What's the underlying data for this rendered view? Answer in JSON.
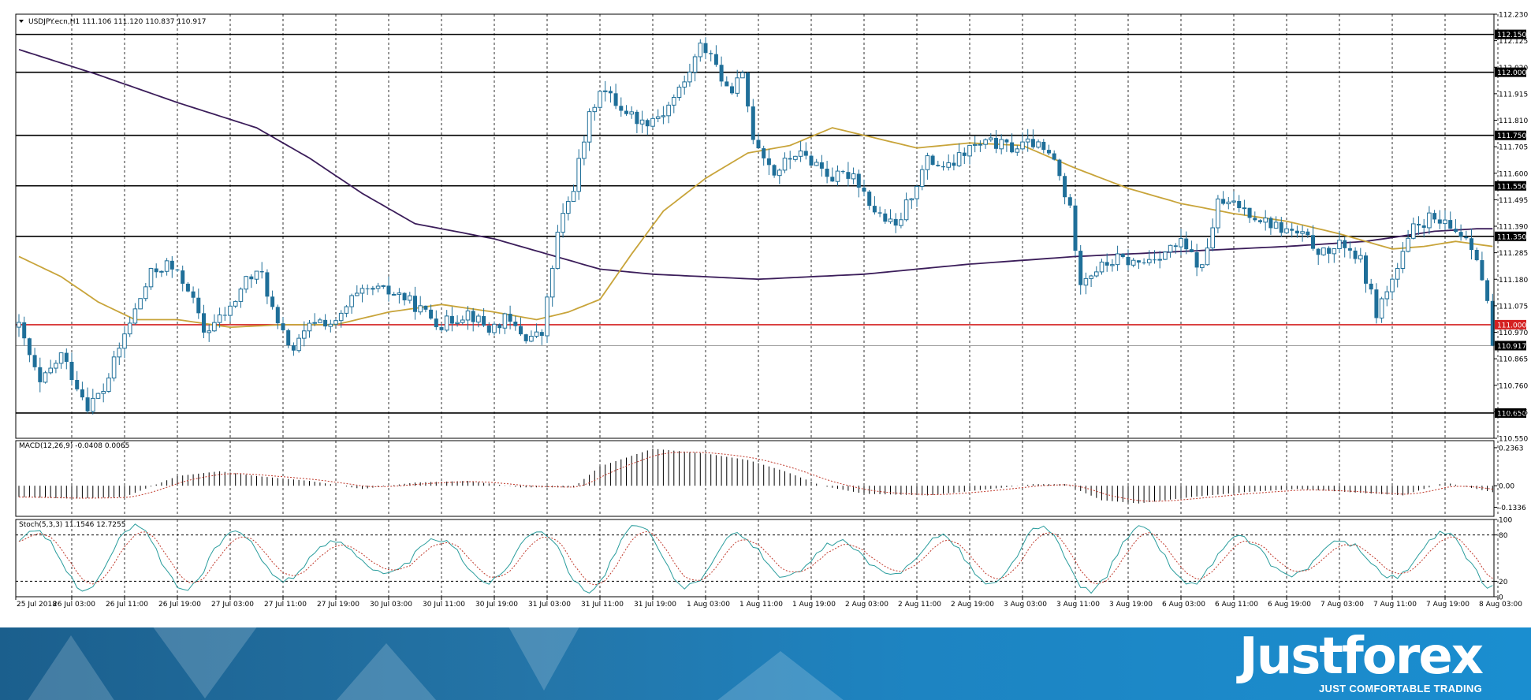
{
  "chart_data": [
    {
      "type": "candlestick",
      "title": "USDJPY.ecn,H1",
      "ohlc_readout": "111.106 111.120 110.837 110.917",
      "ylim": [
        110.55,
        112.23
      ],
      "y_ticks": [
        "112.230",
        "112.125",
        "112.020",
        "111.915",
        "111.810",
        "111.705",
        "111.600",
        "111.495",
        "111.390",
        "111.285",
        "111.180",
        "111.075",
        "110.970",
        "110.865",
        "110.760",
        "110.655",
        "110.550"
      ],
      "x_ticks": [
        "25 Jul 2018",
        "26 Jul 03:00",
        "26 Jul 11:00",
        "26 Jul 19:00",
        "27 Jul 03:00",
        "27 Jul 11:00",
        "27 Jul 19:00",
        "30 Jul 03:00",
        "30 Jul 11:00",
        "30 Jul 19:00",
        "31 Jul 03:00",
        "31 Jul 11:00",
        "31 Jul 19:00",
        "1 Aug 03:00",
        "1 Aug 11:00",
        "1 Aug 19:00",
        "2 Aug 03:00",
        "2 Aug 11:00",
        "2 Aug 19:00",
        "3 Aug 03:00",
        "3 Aug 11:00",
        "3 Aug 19:00",
        "6 Aug 03:00",
        "6 Aug 11:00",
        "6 Aug 19:00",
        "7 Aug 03:00",
        "7 Aug 11:00",
        "7 Aug 19:00",
        "8 Aug 03:00"
      ],
      "horizontal_levels": [
        {
          "label": "112.150",
          "value": 112.15,
          "color": "#000000"
        },
        {
          "label": "112.000",
          "value": 112.0,
          "color": "#000000"
        },
        {
          "label": "111.750",
          "value": 111.75,
          "color": "#000000"
        },
        {
          "label": "111.550",
          "value": 111.55,
          "color": "#000000"
        },
        {
          "label": "111.350",
          "value": 111.35,
          "color": "#000000"
        },
        {
          "label": "111.000",
          "value": 111.0,
          "color": "#d42020"
        },
        {
          "label": "110.917",
          "value": 110.917,
          "color": "#9e9e9e"
        },
        {
          "label": "110.650",
          "value": 110.65,
          "color": "#000000"
        }
      ],
      "close_anchors": [
        [
          0,
          110.99
        ],
        [
          4,
          110.76
        ],
        [
          8,
          110.88
        ],
        [
          10,
          110.8
        ],
        [
          13,
          110.68
        ],
        [
          16,
          110.74
        ],
        [
          20,
          110.96
        ],
        [
          25,
          111.2
        ],
        [
          28,
          111.24
        ],
        [
          32,
          111.15
        ],
        [
          35,
          110.97
        ],
        [
          40,
          111.06
        ],
        [
          43,
          111.18
        ],
        [
          46,
          111.2
        ],
        [
          49,
          110.99
        ],
        [
          52,
          110.9
        ],
        [
          56,
          111.02
        ],
        [
          60,
          111.0
        ],
        [
          63,
          111.1
        ],
        [
          67,
          111.14
        ],
        [
          72,
          111.12
        ],
        [
          76,
          111.06
        ],
        [
          80,
          111.0
        ],
        [
          85,
          111.05
        ],
        [
          89,
          110.98
        ],
        [
          92,
          111.02
        ],
        [
          96,
          110.95
        ],
        [
          99,
          110.96
        ],
        [
          102,
          111.36
        ],
        [
          105,
          111.55
        ],
        [
          108,
          111.82
        ],
        [
          110,
          111.94
        ],
        [
          114,
          111.86
        ],
        [
          118,
          111.8
        ],
        [
          122,
          111.84
        ],
        [
          126,
          111.96
        ],
        [
          129,
          112.1
        ],
        [
          131,
          112.08
        ],
        [
          134,
          111.92
        ],
        [
          137,
          111.98
        ],
        [
          139,
          111.75
        ],
        [
          143,
          111.6
        ],
        [
          147,
          111.68
        ],
        [
          151,
          111.64
        ],
        [
          154,
          111.58
        ],
        [
          158,
          111.6
        ],
        [
          162,
          111.45
        ],
        [
          166,
          111.38
        ],
        [
          169,
          111.52
        ],
        [
          172,
          111.65
        ],
        [
          176,
          111.62
        ],
        [
          180,
          111.7
        ],
        [
          184,
          111.72
        ],
        [
          188,
          111.7
        ],
        [
          192,
          111.72
        ],
        [
          196,
          111.65
        ],
        [
          199,
          111.45
        ],
        [
          201,
          111.18
        ],
        [
          204,
          111.22
        ],
        [
          208,
          111.26
        ],
        [
          212,
          111.24
        ],
        [
          216,
          111.28
        ],
        [
          220,
          111.32
        ],
        [
          224,
          111.22
        ],
        [
          227,
          111.48
        ],
        [
          231,
          111.47
        ],
        [
          235,
          111.42
        ],
        [
          239,
          111.38
        ],
        [
          243,
          111.35
        ],
        [
          247,
          111.28
        ],
        [
          251,
          111.32
        ],
        [
          254,
          111.25
        ],
        [
          257,
          111.05
        ],
        [
          261,
          111.22
        ],
        [
          264,
          111.38
        ],
        [
          267,
          111.42
        ],
        [
          271,
          111.38
        ],
        [
          274,
          111.35
        ],
        [
          276,
          111.28
        ],
        [
          278,
          111.08
        ],
        [
          279,
          110.917
        ]
      ],
      "ma_slow": [
        [
          0,
          112.09
        ],
        [
          15,
          111.99
        ],
        [
          30,
          111.88
        ],
        [
          45,
          111.78
        ],
        [
          55,
          111.66
        ],
        [
          65,
          111.52
        ],
        [
          75,
          111.4
        ],
        [
          90,
          111.34
        ],
        [
          100,
          111.28
        ],
        [
          110,
          111.22
        ],
        [
          120,
          111.2
        ],
        [
          130,
          111.19
        ],
        [
          140,
          111.18
        ],
        [
          150,
          111.19
        ],
        [
          160,
          111.2
        ],
        [
          180,
          111.24
        ],
        [
          200,
          111.27
        ],
        [
          220,
          111.29
        ],
        [
          240,
          111.31
        ],
        [
          255,
          111.33
        ],
        [
          268,
          111.37
        ],
        [
          276,
          111.38
        ],
        [
          279,
          111.38
        ]
      ],
      "ma_fast": [
        [
          0,
          111.27
        ],
        [
          8,
          111.19
        ],
        [
          15,
          111.09
        ],
        [
          22,
          111.02
        ],
        [
          30,
          111.02
        ],
        [
          40,
          110.99
        ],
        [
          50,
          111.0
        ],
        [
          60,
          111.0
        ],
        [
          70,
          111.05
        ],
        [
          80,
          111.08
        ],
        [
          90,
          111.05
        ],
        [
          98,
          111.02
        ],
        [
          104,
          111.05
        ],
        [
          110,
          111.1
        ],
        [
          116,
          111.28
        ],
        [
          122,
          111.45
        ],
        [
          130,
          111.58
        ],
        [
          138,
          111.68
        ],
        [
          146,
          111.71
        ],
        [
          154,
          111.78
        ],
        [
          162,
          111.74
        ],
        [
          170,
          111.7
        ],
        [
          180,
          111.72
        ],
        [
          190,
          111.71
        ],
        [
          200,
          111.62
        ],
        [
          210,
          111.54
        ],
        [
          220,
          111.48
        ],
        [
          230,
          111.44
        ],
        [
          240,
          111.41
        ],
        [
          250,
          111.36
        ],
        [
          260,
          111.3
        ],
        [
          266,
          111.31
        ],
        [
          272,
          111.33
        ],
        [
          279,
          111.31
        ]
      ]
    },
    {
      "type": "bar",
      "title": "MACD(12,26,9) -0.0408 0.0065",
      "ylim": [
        -0.19,
        0.28
      ],
      "y_ticks": [
        "0.2363",
        "0.00",
        "-0.1336"
      ],
      "macd_anchors": [
        [
          0,
          -0.07
        ],
        [
          10,
          -0.08
        ],
        [
          20,
          -0.07
        ],
        [
          30,
          0.06
        ],
        [
          38,
          0.09
        ],
        [
          45,
          0.06
        ],
        [
          55,
          0.03
        ],
        [
          65,
          -0.02
        ],
        [
          75,
          0.02
        ],
        [
          85,
          0.03
        ],
        [
          95,
          -0.01
        ],
        [
          105,
          -0.01
        ],
        [
          110,
          0.12
        ],
        [
          120,
          0.23
        ],
        [
          130,
          0.2
        ],
        [
          138,
          0.16
        ],
        [
          145,
          0.09
        ],
        [
          152,
          0.0
        ],
        [
          160,
          -0.05
        ],
        [
          172,
          -0.06
        ],
        [
          184,
          -0.02
        ],
        [
          192,
          0.01
        ],
        [
          198,
          0.01
        ],
        [
          205,
          -0.09
        ],
        [
          212,
          -0.11
        ],
        [
          222,
          -0.07
        ],
        [
          232,
          -0.04
        ],
        [
          242,
          -0.02
        ],
        [
          252,
          -0.04
        ],
        [
          262,
          -0.06
        ],
        [
          270,
          0.02
        ],
        [
          279,
          -0.04
        ]
      ]
    },
    {
      "type": "line",
      "title": "Stoch(5,3,3) 11.1546 12.7255",
      "ylim": [
        0,
        100
      ],
      "y_ticks": [
        "100",
        "80",
        "20",
        "0"
      ],
      "levels": [
        80,
        20
      ]
    }
  ],
  "footer": {
    "logo": "Justforex",
    "slogan": "JUST COMFORTABLE TRADING"
  }
}
